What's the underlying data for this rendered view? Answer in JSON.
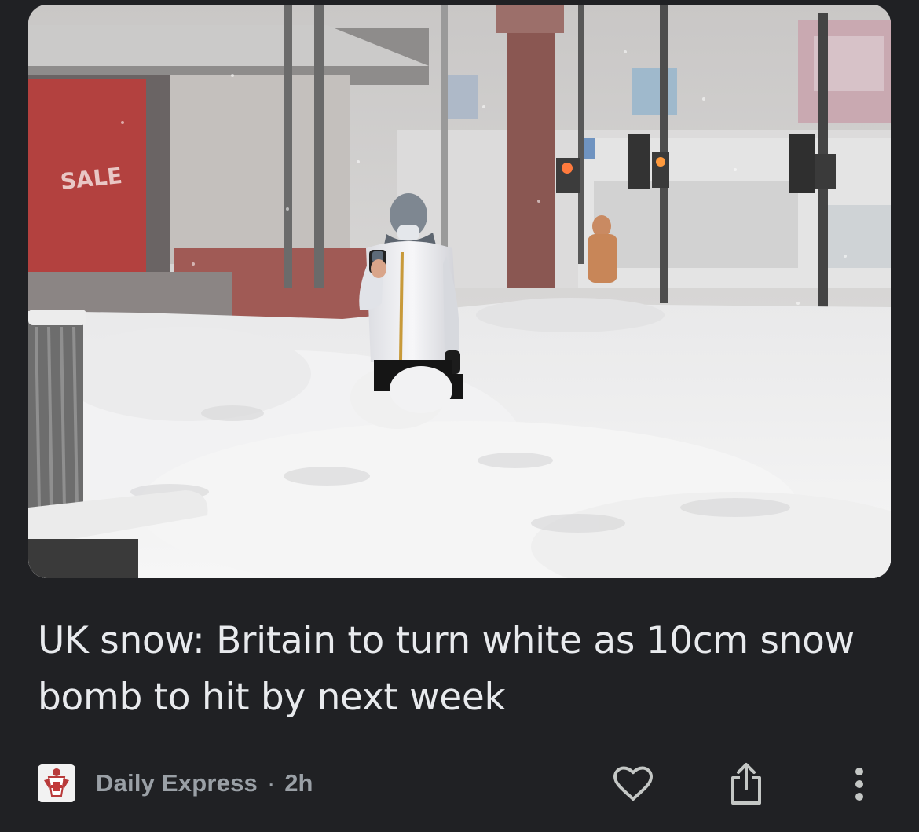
{
  "article": {
    "headline": "UK snow: Britain to turn white as 10cm snow bomb to hit by next week",
    "image_alt": "Person in white jacket and face mask standing in deep snow on a city street looking at a phone",
    "shop_sign_text": "SALE"
  },
  "meta": {
    "source": "Daily Express",
    "separator": "·",
    "age": "2h"
  },
  "actions": {
    "like_icon": "heart-outline-icon",
    "share_icon": "share-icon",
    "more_icon": "more-vertical-icon"
  },
  "colors": {
    "background": "#202124",
    "headline": "#e8eaed",
    "secondary_text": "#9aa0a6",
    "icon": "#c4c7c5"
  }
}
